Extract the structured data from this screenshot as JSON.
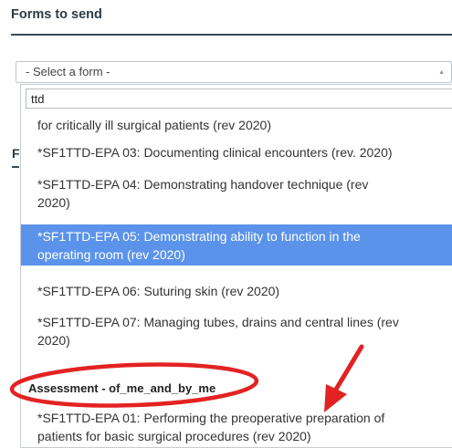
{
  "section": {
    "title": "Forms to send",
    "hidden_heading_fragment": "F"
  },
  "select": {
    "value": "- Select a form -"
  },
  "search": {
    "value": "ttd"
  },
  "options": {
    "partial_top": "for critically ill surgical patients (rev 2020)",
    "epa03": "*SF1TTD-EPA 03: Documenting clinical encounters (rev. 2020)",
    "epa04_line1": "*SF1TTD-EPA 04: Demonstrating handover technique (rev",
    "epa04_line2": "2020)",
    "epa05_line1": "*SF1TTD-EPA 05: Demonstrating ability to function in the",
    "epa05_line2": "operating room (rev 2020)",
    "epa06": "*SF1TTD-EPA 06: Suturing skin (rev 2020)",
    "epa07_line1": "*SF1TTD-EPA 07: Managing tubes, drains and central lines (rev",
    "epa07_line2": "2020)",
    "group_label": "Assessment - of_me_and_by_me",
    "epa01_line1": "*SF1TTD-EPA 01: Performing the preoperative preparation of",
    "epa01_line2": "patients for basic surgical procedures (rev 2020)"
  },
  "colors": {
    "highlight": "#5b93ea",
    "annotation": "#e32222",
    "heading": "#2d3b45"
  }
}
